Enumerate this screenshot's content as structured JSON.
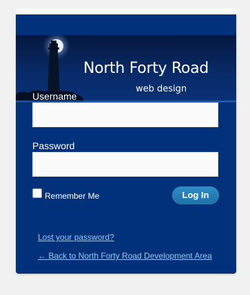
{
  "brand": {
    "name": "North Forty Road",
    "tagline": "web design"
  },
  "form": {
    "username_label": "Username",
    "username_value": "",
    "password_label": "Password",
    "password_value": "",
    "remember_label": "Remember Me",
    "remember_checked": false,
    "submit_label": "Log In"
  },
  "links": {
    "lost_password": "Lost your password?",
    "back_to_site": "← Back to North Forty Road Development Area"
  },
  "colors": {
    "panel_background": "#00317a",
    "button": "#2581b9",
    "link": "#9ec7ee"
  },
  "icons": {
    "logo": "lighthouse-icon"
  }
}
